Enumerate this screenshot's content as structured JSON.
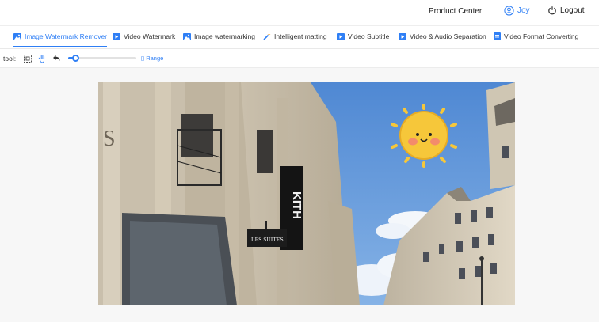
{
  "header": {
    "product_center_label": "Product Center",
    "user_name": "Joy",
    "logout_label": "Logout"
  },
  "tabs": [
    {
      "label": "Image Watermark Remover",
      "active": true,
      "icon": "image-icon",
      "color": "#2f7ff5"
    },
    {
      "label": "Video Watermark",
      "active": false,
      "icon": "video-icon",
      "color": "#2f7ff5"
    },
    {
      "label": "Image watermarking",
      "active": false,
      "icon": "image-icon",
      "color": "#2f7ff5"
    },
    {
      "label": "Intelligent matting",
      "active": false,
      "icon": "magic-wand-icon",
      "color": "#2f7ff5"
    },
    {
      "label": "Video Subtitle",
      "active": false,
      "icon": "video-icon",
      "color": "#2f7ff5"
    },
    {
      "label": "Video & Audio Separation",
      "active": false,
      "icon": "video-icon",
      "color": "#2f7ff5"
    },
    {
      "label": "Video Format Converting",
      "active": false,
      "icon": "file-icon",
      "color": "#2f7ff5"
    }
  ],
  "toolbar": {
    "tool_label": "tool:",
    "tools": [
      "select-rect-icon",
      "hand-icon",
      "undo-icon"
    ],
    "brush_size": 0.1,
    "range_label": "Range"
  },
  "image": {
    "signs": [
      "KITH",
      "LES SUITES",
      "S"
    ]
  },
  "colors": {
    "accent": "#2f7ff5",
    "sky": "#5b93d8",
    "sun": "#f6c73a"
  }
}
